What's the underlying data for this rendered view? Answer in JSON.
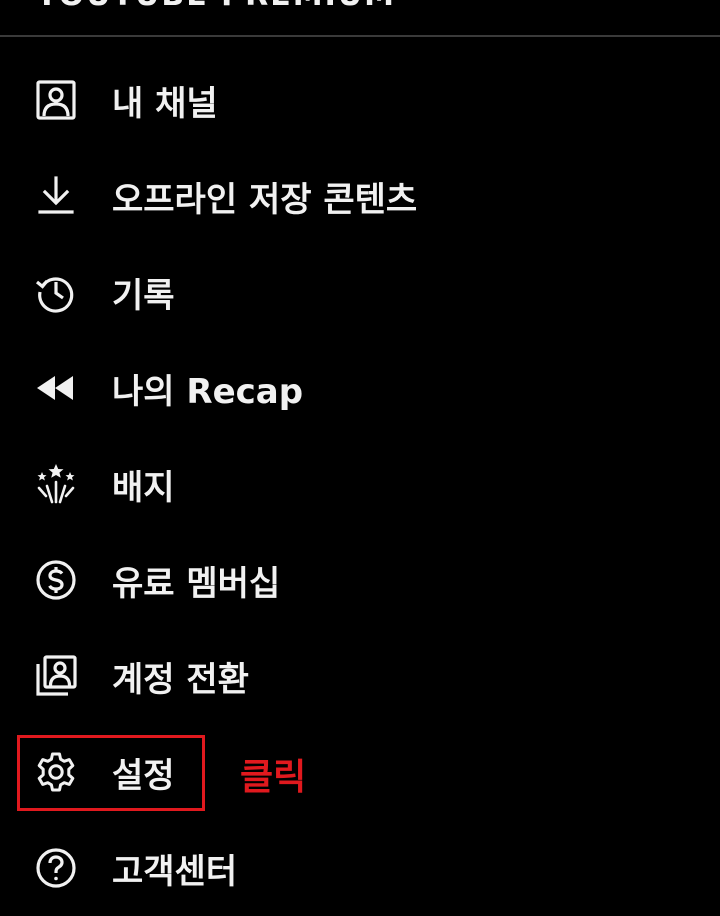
{
  "header": {
    "cut_title": "YOUTUBE PREMIUM"
  },
  "menu": {
    "items": [
      {
        "label": "내 채널",
        "icon": "account-box-icon"
      },
      {
        "label": "오프라인 저장 콘텐츠",
        "icon": "download-icon"
      },
      {
        "label": "기록",
        "icon": "history-icon"
      },
      {
        "label": "나의 Recap",
        "icon": "rewind-icon"
      },
      {
        "label": "배지",
        "icon": "badge-icon"
      },
      {
        "label": "유료 멤버십",
        "icon": "dollar-circle-icon"
      },
      {
        "label": "계정 전환",
        "icon": "switch-account-icon"
      },
      {
        "label": "설정",
        "icon": "gear-icon"
      },
      {
        "label": "고객센터",
        "icon": "help-circle-icon"
      }
    ]
  },
  "annotation": {
    "text": "클릭",
    "color": "#e0191e"
  },
  "colors": {
    "background": "#000000",
    "text": "#f1f1f1",
    "divider": "#3a3a3a",
    "highlight": "#e0191e"
  }
}
